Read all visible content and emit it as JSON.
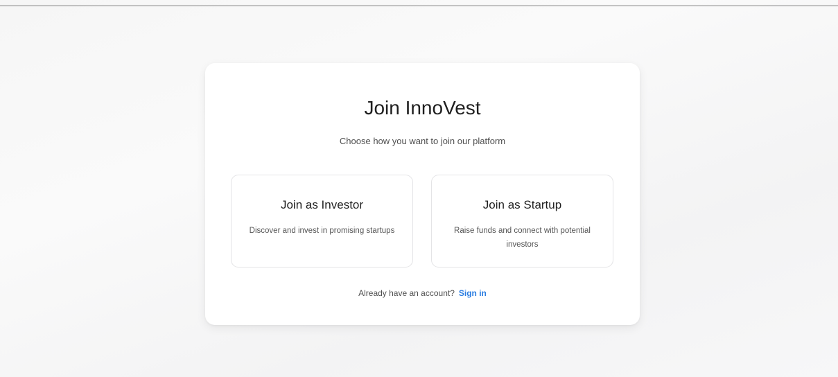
{
  "card": {
    "title": "Join InnoVest",
    "subtitle": "Choose how you want to join our platform"
  },
  "options": [
    {
      "title": "Join as Investor",
      "description": "Discover and invest in promising startups"
    },
    {
      "title": "Join as Startup",
      "description": "Raise funds and connect with potential investors"
    }
  ],
  "footer": {
    "prompt": "Already have an account?",
    "signin_label": "Sign in"
  },
  "colors": {
    "link": "#2a7de1",
    "card_background": "#ffffff",
    "page_background": "#f6f6f6"
  }
}
